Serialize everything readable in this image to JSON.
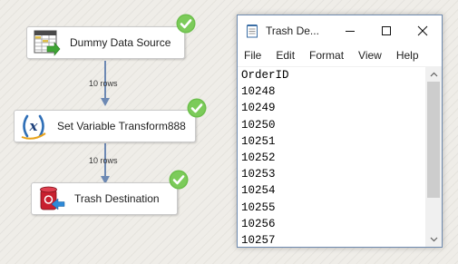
{
  "flow": {
    "tasks": [
      {
        "label": "Dummy Data Source",
        "icon": "data-source-icon",
        "status": "success"
      },
      {
        "label": "Set Variable Transform888",
        "icon": "variable-transform-icon",
        "status": "success"
      },
      {
        "label": "Trash Destination",
        "icon": "trash-destination-icon",
        "status": "success"
      }
    ],
    "connectors": [
      {
        "label": "10 rows"
      },
      {
        "label": "10 rows"
      }
    ]
  },
  "notepad": {
    "title": "Trash De...",
    "menu": [
      "File",
      "Edit",
      "Format",
      "View",
      "Help"
    ],
    "lines": [
      "OrderID",
      "10248",
      "10249",
      "10250",
      "10251",
      "10252",
      "10253",
      "10254",
      "10255",
      "10256",
      "10257"
    ]
  },
  "colors": {
    "success_green": "#6cbf4b",
    "connector_blue": "#6d89b3",
    "canvas_background": "#efede8"
  }
}
